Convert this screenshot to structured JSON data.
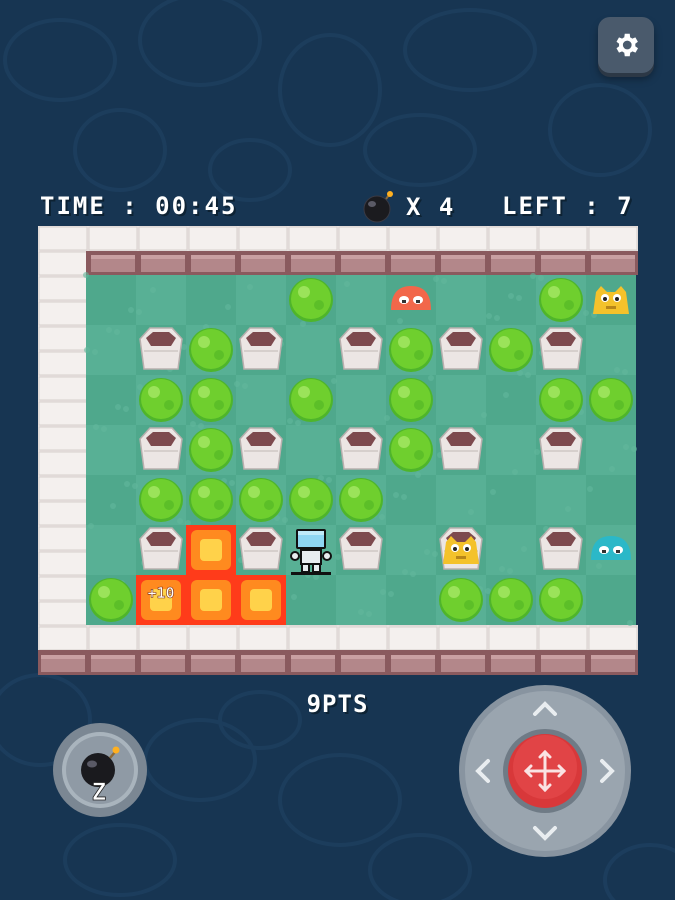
{
  "hud": {
    "time_label": "TIME : 00:45",
    "bombs_label": "X 4",
    "left_label": "LEFT : 7"
  },
  "score": {
    "label": "9PTS"
  },
  "board": {
    "cols": 11,
    "rows": 7,
    "walls": [
      [
        1,
        1
      ],
      [
        3,
        1
      ],
      [
        5,
        1
      ],
      [
        7,
        1
      ],
      [
        9,
        1
      ],
      [
        1,
        3
      ],
      [
        3,
        3
      ],
      [
        5,
        3
      ],
      [
        7,
        3
      ],
      [
        9,
        3
      ],
      [
        1,
        5
      ],
      [
        3,
        5
      ],
      [
        5,
        5
      ],
      [
        7,
        5
      ],
      [
        9,
        5
      ]
    ],
    "bushes": [
      [
        4,
        0
      ],
      [
        9,
        0
      ],
      [
        2,
        1
      ],
      [
        6,
        1
      ],
      [
        8,
        1
      ],
      [
        1,
        2
      ],
      [
        2,
        2
      ],
      [
        4,
        2
      ],
      [
        6,
        2
      ],
      [
        9,
        2
      ],
      [
        10,
        2
      ],
      [
        2,
        3
      ],
      [
        6,
        3
      ],
      [
        1,
        4
      ],
      [
        2,
        4
      ],
      [
        3,
        4
      ],
      [
        4,
        4
      ],
      [
        5,
        4
      ],
      [
        0,
        6
      ],
      [
        7,
        6
      ],
      [
        8,
        6
      ],
      [
        9,
        6
      ]
    ],
    "flames": [
      [
        2,
        5
      ],
      [
        1,
        6
      ],
      [
        2,
        6
      ],
      [
        3,
        6
      ]
    ],
    "player": [
      4,
      5
    ],
    "enemies": [
      {
        "kind": "orange-blob",
        "cell": [
          6,
          0
        ],
        "color": "#f2674a"
      },
      {
        "kind": "yellow-monster",
        "cell": [
          10,
          0
        ],
        "color": "#f4c22b"
      },
      {
        "kind": "yellow-monster",
        "cell": [
          7,
          5
        ],
        "color": "#f4c22b"
      },
      {
        "kind": "cyan-blob",
        "cell": [
          10,
          5
        ],
        "color": "#2bb8c8"
      }
    ],
    "popup": {
      "text": "+10",
      "cell": [
        1,
        6
      ]
    }
  },
  "controls": {
    "bomb_key": "Z",
    "dpad_icon": "move-arrows-icon"
  },
  "colors": {
    "background": "#173552",
    "grass": "#4fa88c",
    "bush": "#6fcf2e",
    "flame": "#ff5a1f",
    "dpad_center": "#d8383a"
  }
}
